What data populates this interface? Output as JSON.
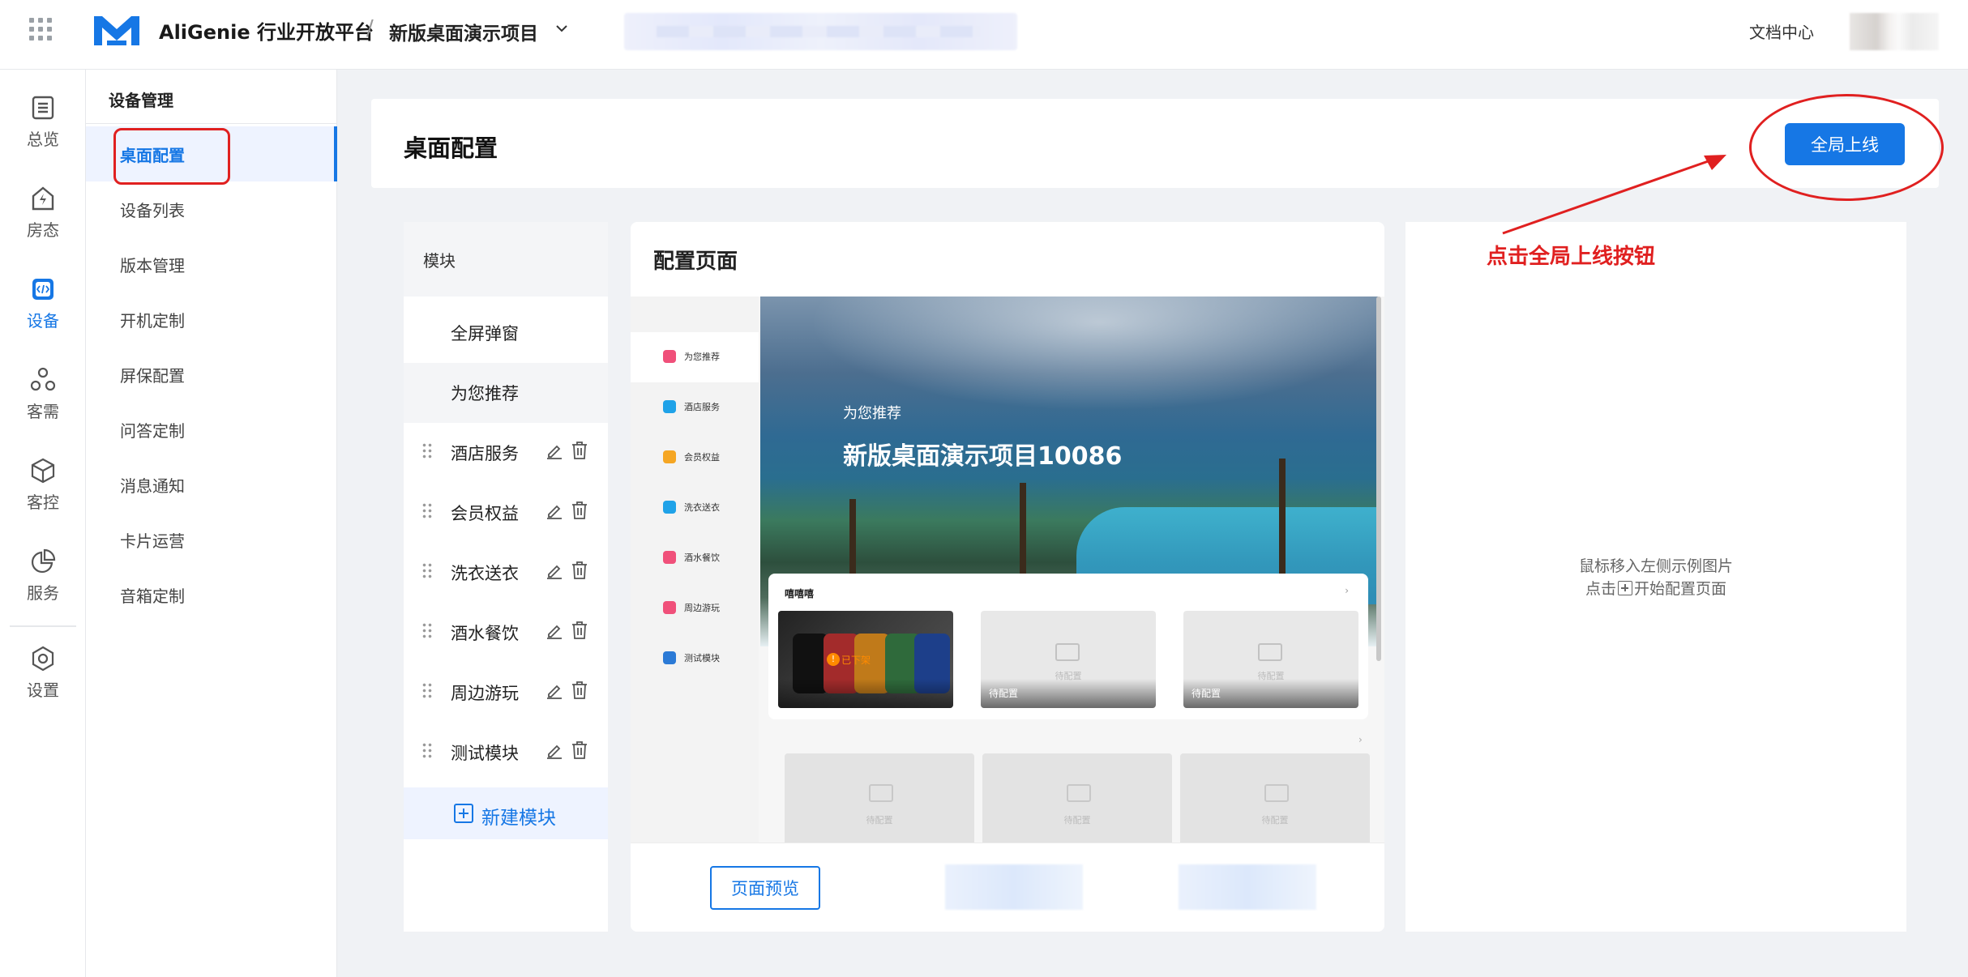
{
  "header": {
    "brand": "AliGenie 行业开放平台",
    "separator": "/",
    "project": "新版桌面演示项目",
    "doc_link": "文档中心"
  },
  "rail": {
    "items": [
      {
        "label": "总览",
        "icon": "list-icon"
      },
      {
        "label": "房态",
        "icon": "house-bolt-icon"
      },
      {
        "label": "设备",
        "icon": "code-icon",
        "active": true
      },
      {
        "label": "客需",
        "icon": "people-icon"
      },
      {
        "label": "客控",
        "icon": "cube-icon"
      },
      {
        "label": "服务",
        "icon": "pie-chart-icon"
      },
      {
        "label": "设置",
        "icon": "gear-icon"
      }
    ]
  },
  "subnav": {
    "title": "设备管理",
    "items": [
      "桌面配置",
      "设备列表",
      "版本管理",
      "开机定制",
      "屏保配置",
      "问答定制",
      "消息通知",
      "卡片运营",
      "音箱定制"
    ],
    "active": "桌面配置"
  },
  "page": {
    "title": "桌面配置",
    "publish_button": "全局上线"
  },
  "modules": {
    "header": "模块",
    "fixed": [
      "全屏弹窗",
      "为您推荐"
    ],
    "editable": [
      "酒店服务",
      "会员权益",
      "洗衣送衣",
      "酒水餐饮",
      "周边游玩",
      "测试模块"
    ],
    "new_button": "新建模块"
  },
  "config": {
    "title": "配置页面",
    "preview_nav": [
      "为您推荐",
      "酒店服务",
      "会员权益",
      "洗衣送衣",
      "酒水餐饮",
      "周边游玩",
      "测试模块"
    ],
    "preview_nav_colors": [
      "#f0507a",
      "#1fa2e8",
      "#f5a623",
      "#1fa2e8",
      "#f0507a",
      "#f0507a",
      "#2b7ad6"
    ],
    "hero_subtitle": "为您推荐",
    "hero_title": "新版桌面演示项目10086",
    "card_row_title": "嘻嘻嘻",
    "card_row_chevron": "›",
    "tiles": [
      {
        "label": "",
        "badge": "已下架",
        "badge_icon": "!"
      },
      {
        "label": "待配置",
        "placeholder": "待配置"
      },
      {
        "label": "待配置",
        "placeholder": "待配置"
      }
    ],
    "more_chevron": "›",
    "bottom_tiles": [
      "待配置",
      "待配置",
      "待配置"
    ],
    "preview_button": "页面预览"
  },
  "right_panel": {
    "hint_line1": "鼠标移入左侧示例图片",
    "hint_line2_prefix": "点击",
    "hint_line2_suffix": "开始配置页面"
  },
  "annotation": {
    "text": "点击全局上线按钮",
    "color": "#e02020"
  },
  "colors": {
    "accent": "#1677e5"
  }
}
